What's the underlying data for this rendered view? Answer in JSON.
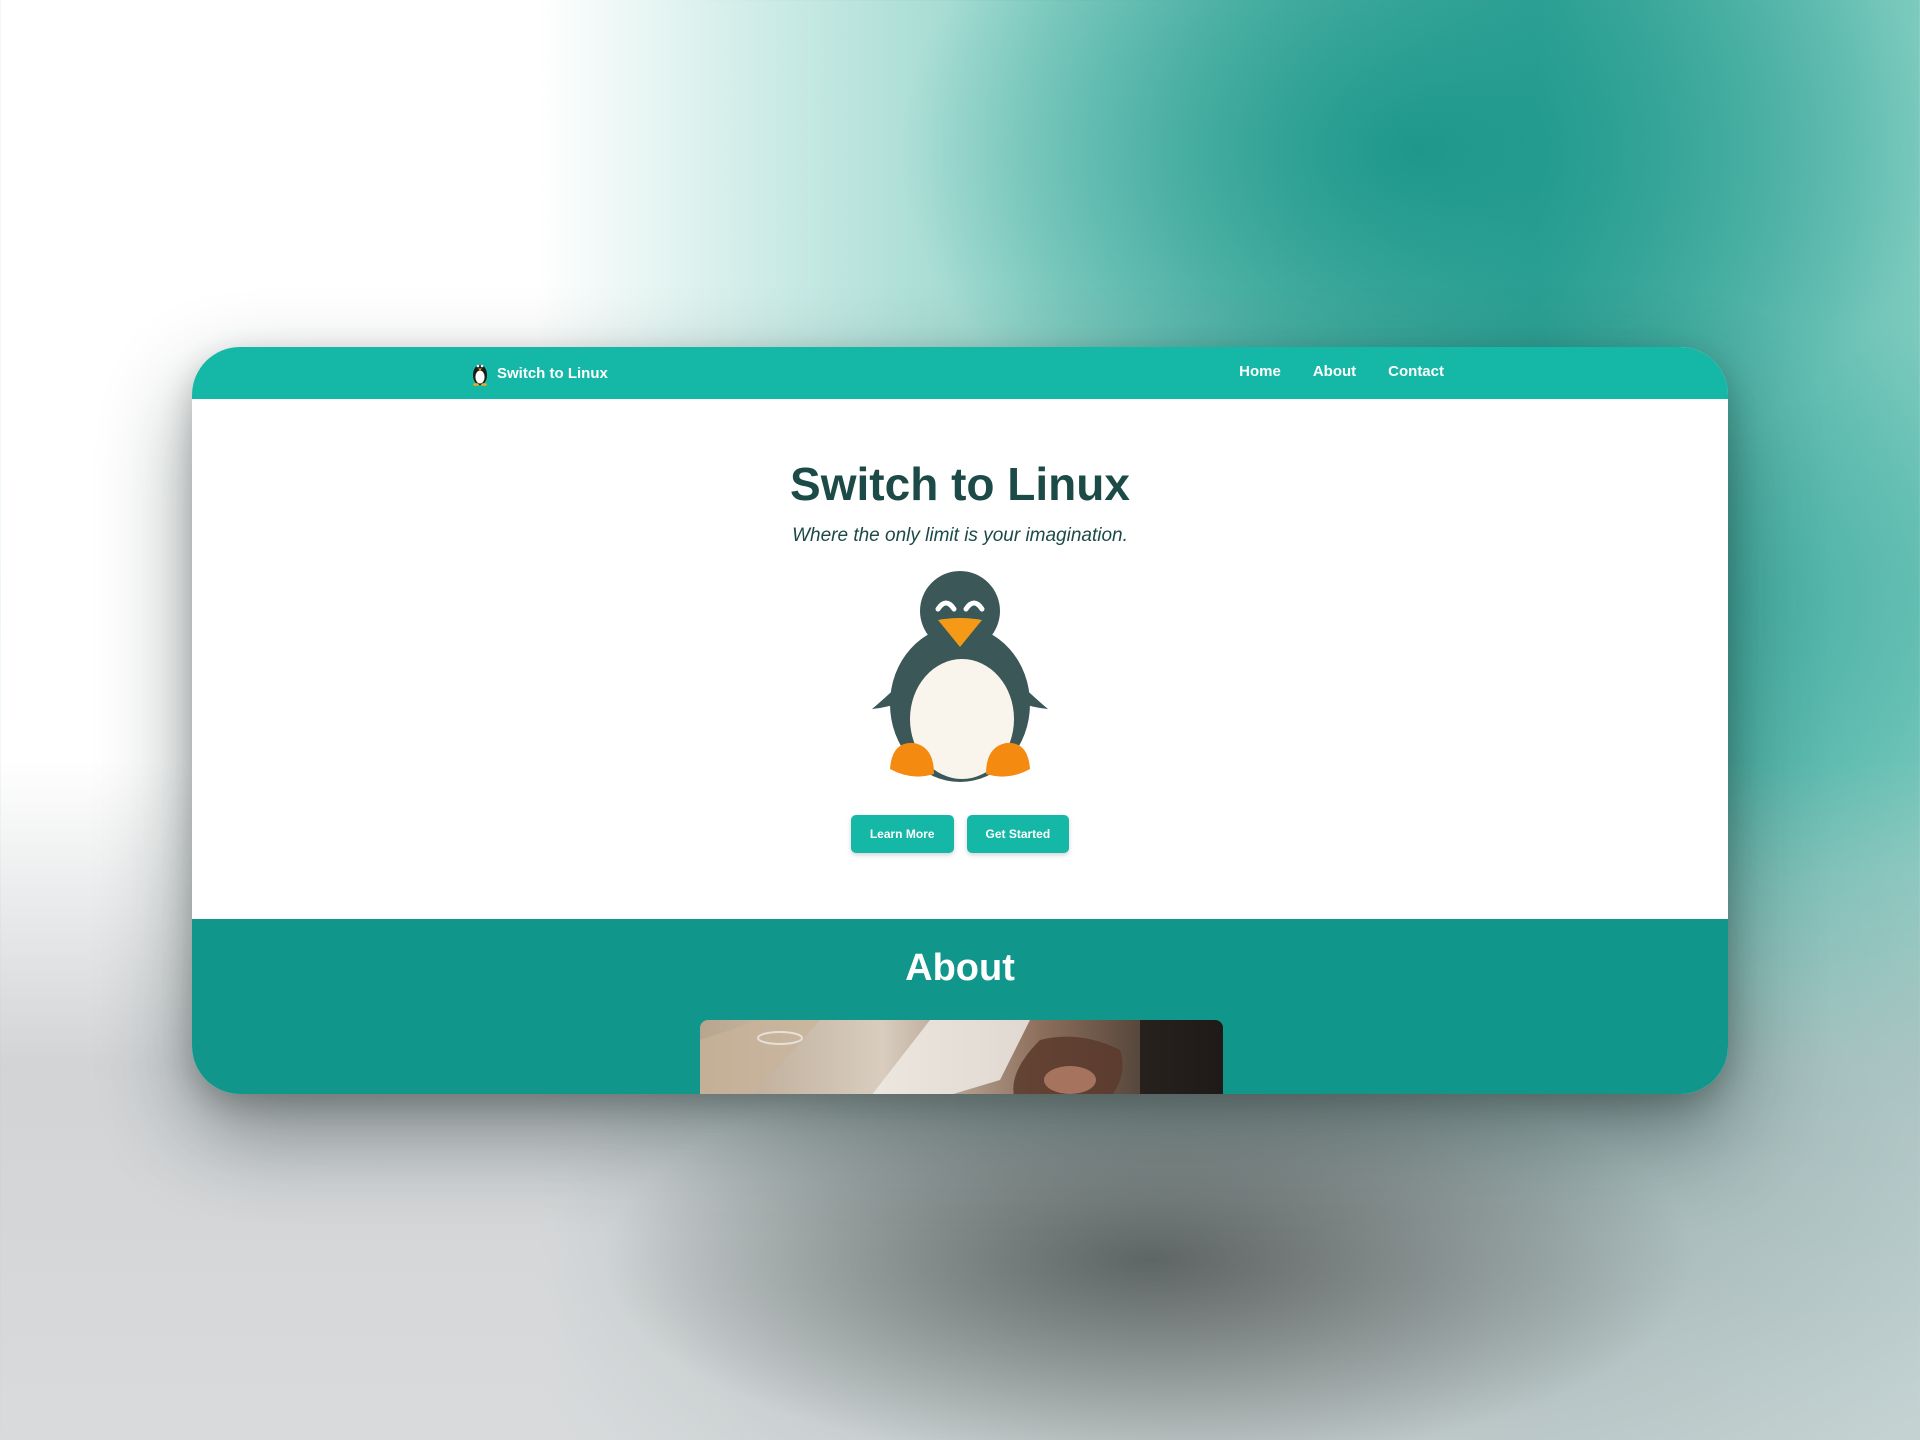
{
  "navbar": {
    "brand_label": "Switch to Linux",
    "brand_icon": "penguin-icon",
    "links": [
      {
        "label": "Home"
      },
      {
        "label": "About"
      },
      {
        "label": "Contact"
      }
    ],
    "background_color": "#15b8a6"
  },
  "hero": {
    "title": "Switch to Linux",
    "subtitle": "Where the only limit is your imagination.",
    "mascot": "penguin-illustration",
    "buttons": {
      "learn_more": "Learn More",
      "get_started": "Get Started"
    }
  },
  "about": {
    "title": "About",
    "image": "about-photo",
    "background_color": "#10968a"
  },
  "colors": {
    "accent": "#15b8a6",
    "heading": "#1c4a46",
    "section_bg": "#10968a"
  }
}
